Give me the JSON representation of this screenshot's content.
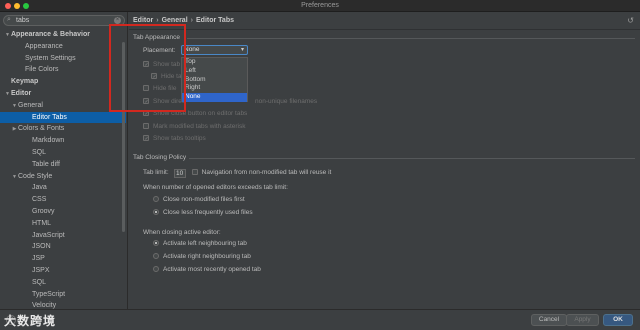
{
  "window": {
    "title": "Preferences"
  },
  "search": {
    "value": "tabs",
    "icon": "search-icon"
  },
  "tree": [
    {
      "label": "Appearance & Behavior",
      "level": 0,
      "arrow": "▼",
      "bold": true
    },
    {
      "label": "Appearance",
      "level": 2
    },
    {
      "label": "System Settings",
      "level": 2
    },
    {
      "label": "File Colors",
      "level": 2
    },
    {
      "label": "Keymap",
      "level": 0,
      "bold": true
    },
    {
      "label": "Editor",
      "level": 0,
      "arrow": "▼",
      "bold": true
    },
    {
      "label": "General",
      "level": 1,
      "arrow": "▼"
    },
    {
      "label": "Editor Tabs",
      "level": 3,
      "selected": true
    },
    {
      "label": "Colors & Fonts",
      "level": 1,
      "arrow": "▶"
    },
    {
      "label": "Markdown",
      "level": 3
    },
    {
      "label": "SQL",
      "level": 3
    },
    {
      "label": "Table diff",
      "level": 3
    },
    {
      "label": "Code Style",
      "level": 1,
      "arrow": "▼"
    },
    {
      "label": "Java",
      "level": 3
    },
    {
      "label": "CSS",
      "level": 3
    },
    {
      "label": "Groovy",
      "level": 3
    },
    {
      "label": "HTML",
      "level": 3
    },
    {
      "label": "JavaScript",
      "level": 3
    },
    {
      "label": "JSON",
      "level": 3
    },
    {
      "label": "JSP",
      "level": 3
    },
    {
      "label": "JSPX",
      "level": 3
    },
    {
      "label": "SQL",
      "level": 3
    },
    {
      "label": "TypeScript",
      "level": 3
    },
    {
      "label": "Velocity",
      "level": 3
    }
  ],
  "breadcrumb": [
    "Editor",
    "General",
    "Editor Tabs"
  ],
  "tab_appearance": {
    "heading": "Tab Appearance",
    "placement_label": "Placement:",
    "placement_value": "None",
    "placement_options": [
      "Top",
      "Left",
      "Bottom",
      "Right",
      "None"
    ],
    "rows": [
      {
        "label": "Show tab",
        "checked": true
      },
      {
        "label": "Hide tab",
        "checked": true,
        "indent": true
      },
      {
        "label": "Hide file",
        "checked": false
      },
      {
        "label": "Show direc",
        "checked": true,
        "suffix": "non-unique filenames"
      },
      {
        "label": "Show close button on editor tabs",
        "checked": true
      },
      {
        "label": "Mark modified tabs with asterisk",
        "checked": false
      },
      {
        "label": "Show tabs tooltips",
        "checked": true
      }
    ]
  },
  "tab_closing": {
    "heading": "Tab Closing Policy",
    "tab_limit_label": "Tab limit:",
    "tab_limit_value": "10",
    "nav_label": "Navigation from non-modified tab will reuse it",
    "exceeds_label": "When number of opened editors exceeds tab limit:",
    "exceeds_options": [
      {
        "label": "Close non-modified files first",
        "checked": false
      },
      {
        "label": "Close less frequently used files",
        "checked": true
      }
    ],
    "closing_label": "When closing active editor:",
    "closing_options": [
      {
        "label": "Activate left neighbouring tab",
        "checked": true
      },
      {
        "label": "Activate right neighbouring tab",
        "checked": false
      },
      {
        "label": "Activate most recently opened tab",
        "checked": false
      }
    ]
  },
  "buttons": {
    "cancel": "Cancel",
    "apply": "Apply",
    "ok": "OK"
  },
  "watermark": "大数跨境",
  "colors": {
    "selection": "#0d5ea6",
    "highlight_box": "#d2281f",
    "ok_button": "#365880"
  }
}
